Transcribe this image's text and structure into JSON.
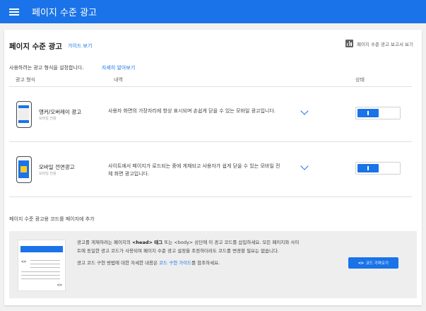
{
  "header": {
    "title": "페이지 수준 광고"
  },
  "page": {
    "title": "페이지 수준 광고",
    "guide_link": "가이드 보기",
    "report_link": "페이지 수준 광고 보고서 보기",
    "instruction": "사용하려는 광고 형식을 설정합니다.",
    "learn_more": "자세히 알아보기"
  },
  "table": {
    "headers": [
      "광고 형식",
      "내역",
      "상태"
    ],
    "rows": [
      {
        "name": "앵커/오버레이 광고",
        "sub": "모바일 전용",
        "desc": "사용자 화면의 가장자리에 항상 표시되며 손쉽게 닫을 수 있는 모바일 광고입니다.",
        "icon": "anchor-phone-icon",
        "status": true
      },
      {
        "name": "모바일 전면광고",
        "sub": "모바일 전용",
        "desc": "사이트에서 페이지가 로드되는 중에 게재되고 사용자가 쉽게 닫을 수 있는 모바일 전체 화면 광고입니다.",
        "icon": "vignette-phone-icon",
        "status": true
      }
    ]
  },
  "code_section": {
    "title": "페이지 수준 광고용 코드를 페이지에 추가",
    "line1_a": "광고를 게재하려는 페이지의 ",
    "line1_b": "<head> 태그",
    "line1_c": " 또는 <body> 상단에 이 광고 코드를 삽입하세요. 모든 페이지와 사이",
    "line2": "트에 동일한 광고 코드가 사용되며 페이지 수준 광고 설정을 조정하더라도 코드를 변경할 필요는 없습니다.",
    "line3_a": "광고 코드 구현 방법에 대한 자세한 내용은 ",
    "line3_link": "코드 구현 가이드",
    "line3_b": "를 참조하세요.",
    "button_icon": "<>",
    "button_label": "코드 가져오기",
    "illus_code_left": "<>",
    "illus_code_right": "<>"
  },
  "colors": {
    "primary": "#1a73e8",
    "accent": "#ffca28"
  }
}
